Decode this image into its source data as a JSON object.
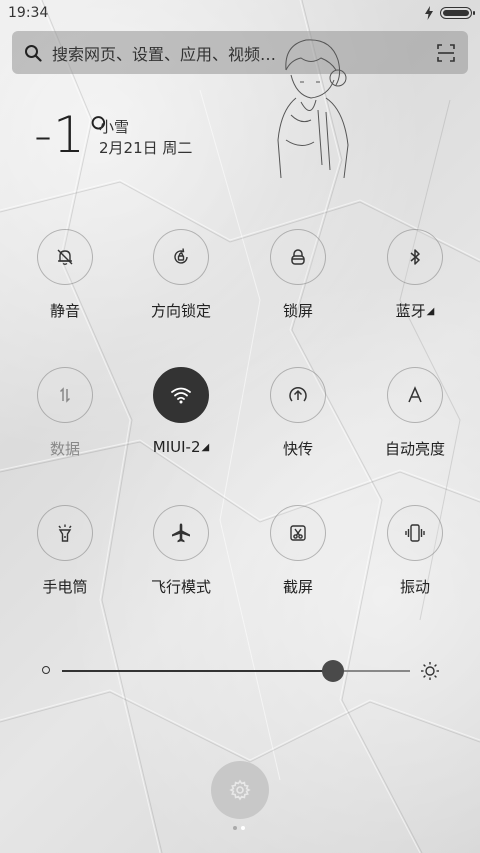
{
  "status_bar": {
    "time": "19:34",
    "icons": [
      "charging-icon",
      "battery-icon"
    ]
  },
  "search": {
    "placeholder": "搜索网页、设置、应用、视频…",
    "icons": [
      "search-icon",
      "scan-icon"
    ]
  },
  "weather": {
    "temperature": "-1°",
    "condition": "小雪",
    "date": "2月21日 周二"
  },
  "toggles": [
    {
      "label": "静音",
      "icon": "bell-off-icon",
      "active": false
    },
    {
      "label": "方向锁定",
      "icon": "rotation-lock-icon",
      "active": false
    },
    {
      "label": "锁屏",
      "icon": "lock-icon",
      "active": false
    },
    {
      "label": "蓝牙",
      "icon": "bluetooth-icon",
      "active": false,
      "expandable": true
    },
    {
      "label": "数据",
      "icon": "mobile-data-icon",
      "active": false,
      "disabled": true
    },
    {
      "label": "MIUI-2",
      "icon": "wifi-icon",
      "active": true,
      "expandable": true
    },
    {
      "label": "快传",
      "icon": "share-upload-icon",
      "active": false
    },
    {
      "label": "自动亮度",
      "icon": "auto-brightness-icon",
      "active": false
    },
    {
      "label": "手电筒",
      "icon": "flashlight-icon",
      "active": false
    },
    {
      "label": "飞行模式",
      "icon": "airplane-icon",
      "active": false
    },
    {
      "label": "截屏",
      "icon": "screenshot-icon",
      "active": false
    },
    {
      "label": "振动",
      "icon": "vibrate-icon",
      "active": false
    }
  ],
  "brightness": {
    "level": 0.78,
    "icons": [
      "brightness-low-icon",
      "brightness-high-icon"
    ]
  },
  "bottom": {
    "icon": "gear-icon",
    "pages": 2,
    "current_page": 2
  },
  "colors": {
    "active_toggle": "#333333",
    "text": "#222222",
    "disabled_text": "#888888"
  }
}
